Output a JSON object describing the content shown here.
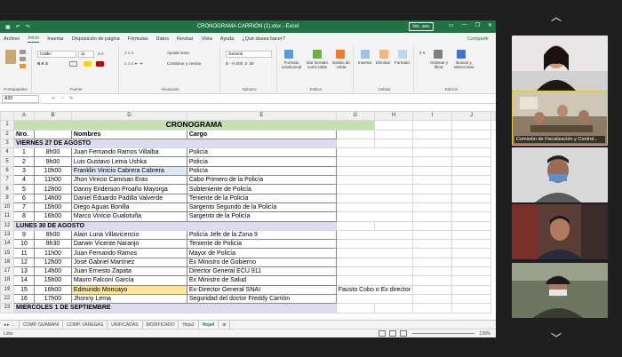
{
  "titlebar": {
    "title": "CRONOGRAMA CARRIÓN (1).xlsx - Excel",
    "signin": "Inic. ses.",
    "qa_icons": [
      "save-icon",
      "undo-icon",
      "redo-icon"
    ]
  },
  "menu": {
    "items": [
      "Archivo",
      "Inicio",
      "Insertar",
      "Disposición de página",
      "Fórmulas",
      "Datos",
      "Revisar",
      "Vista",
      "Ayuda",
      "¿Qué desea hacer?"
    ],
    "active": 1,
    "share": "Compartir"
  },
  "ribbon": {
    "portapapeles": "Portapapeles",
    "fuente": "Fuente",
    "font_name": "Calibri",
    "font_size": "11",
    "font_style": "N  K  S",
    "alineacion": "Alineación",
    "ajustar_texto": "Ajustar texto",
    "combinar": "Combinar y centrar",
    "numero": "Número",
    "number_format": "General",
    "estilos": "Estilos",
    "formato_condicional": "Formato condicional",
    "dar_formato": "Dar formato como tabla",
    "estilos_celda": "Estilos de celda",
    "celdas": "Celdas",
    "insertar": "Insertar",
    "eliminar": "Eliminar",
    "formato": "Formato",
    "edicion": "Edición",
    "ordenar": "Ordenar y filtrar",
    "buscar": "Buscar y seleccionar"
  },
  "formula": {
    "name_box": "A33"
  },
  "grid": {
    "columns": [
      "A",
      "B",
      "D",
      "E",
      "G",
      "H",
      "I",
      "J"
    ],
    "title": "CRONOGRAMA",
    "headers": {
      "nro": "Nro.",
      "nombres": "Nombres",
      "cargo": "Cargo"
    },
    "rows": [
      {
        "r": "3",
        "day": "VIERNES 27 DE AGOSTO"
      },
      {
        "r": "4",
        "nro": "1",
        "hora": "8h00",
        "nombre": "Juan Fernando Ramos Villalba",
        "cargo": "Policía",
        "extra": ""
      },
      {
        "r": "5",
        "nro": "2",
        "hora": "9h00",
        "nombre": "Luis Gustavo Lema Ushka",
        "cargo": "Policía",
        "extra": ""
      },
      {
        "r": "6",
        "nro": "3",
        "hora": "10h00",
        "nombre": "Franklin Vinicio Cabrera Cabrera",
        "cargo": "Policía",
        "extra": "",
        "hl": "blue"
      },
      {
        "r": "7",
        "nro": "4",
        "hora": "11h00",
        "nombre": "Jhon Vinicio Camisan Eras",
        "cargo": "Cabo Primero de la Policía",
        "extra": ""
      },
      {
        "r": "8",
        "nro": "5",
        "hora": "12h00",
        "nombre": "Danny Enderson Proaño Mayorga",
        "cargo": "Subteniente de Policía",
        "extra": ""
      },
      {
        "r": "9",
        "nro": "6",
        "hora": "14h00",
        "nombre": "Daniel Eduardo Padilla Valverde",
        "cargo": "Teniente de la Policía",
        "extra": ""
      },
      {
        "r": "10",
        "nro": "7",
        "hora": "15h00",
        "nombre": "Diego Aguas Bonilla",
        "cargo": "Sargento Segundo de la Policía",
        "extra": ""
      },
      {
        "r": "11",
        "nro": "8",
        "hora": "16h00",
        "nombre": "Marco Vinicio Gualotuña",
        "cargo": "Sargento de la Policía",
        "extra": ""
      },
      {
        "r": "12",
        "day": "LUNES 30 DE AGOSTO"
      },
      {
        "r": "13",
        "nro": "9",
        "hora": "8h00",
        "nombre": "Alain Luna Villavicencio",
        "cargo": "Policía Jefe de la Zona 9",
        "extra": ""
      },
      {
        "r": "14",
        "nro": "10",
        "hora": "9h30",
        "nombre": " Darwin Vicente Naranjo",
        "cargo": "Teniente de Policía",
        "extra": ""
      },
      {
        "r": "15",
        "nro": "11",
        "hora": "11h00",
        "nombre": " Juan Fernando Ramos",
        "cargo": "Mayor de Policía",
        "extra": ""
      },
      {
        "r": "16",
        "nro": "12",
        "hora": "12h00",
        "nombre": "José Gabriel Martínez",
        "cargo": "Ex Ministro de Gobierno",
        "extra": ""
      },
      {
        "r": "17",
        "nro": "13",
        "hora": "14h00",
        "nombre": "Juan Ernesto Zapata",
        "cargo": "Director General ECU 911",
        "extra": ""
      },
      {
        "r": "18",
        "nro": "14",
        "hora": "15h00",
        "nombre": "Mauro Falconí García",
        "cargo": "Ex Ministro de Salud",
        "extra": ""
      },
      {
        "r": "19",
        "nro": "15",
        "hora": "16h00",
        "nombre": "Edmundo Moncayo",
        "cargo": "Ex-Director General SNAI",
        "extra": "Fausto Cobo o Ex director",
        "hl": "orange"
      },
      {
        "r": "22",
        "nro": "16",
        "hora": "17h00",
        "nombre": "Jhonny Lema",
        "cargo": "Seguridad del doctor Freddy Carrión",
        "extra": ""
      },
      {
        "r": "23",
        "day": "MIERCOLES 1 DE SEPTIEMBRE"
      }
    ]
  },
  "sheets": {
    "tabs": [
      "COMP. GUAMANÍ",
      "COMP. VANEGAS",
      "UNIFICADAS",
      "MODIFICADO",
      "Hoja3",
      "Hoja4"
    ],
    "active": 5
  },
  "status": {
    "left": "Listo",
    "zoom": "130%"
  },
  "video": {
    "tiles": [
      {
        "label": "",
        "bg": "#e8e4e6"
      },
      {
        "label": "Comisión de Fiscalización y Control...",
        "bg": "#c9c2b3"
      },
      {
        "label": "",
        "bg": "#d8d8d8"
      },
      {
        "label": "",
        "bg": "#5a3e35"
      },
      {
        "label": "",
        "bg": "#6e7560"
      }
    ]
  }
}
